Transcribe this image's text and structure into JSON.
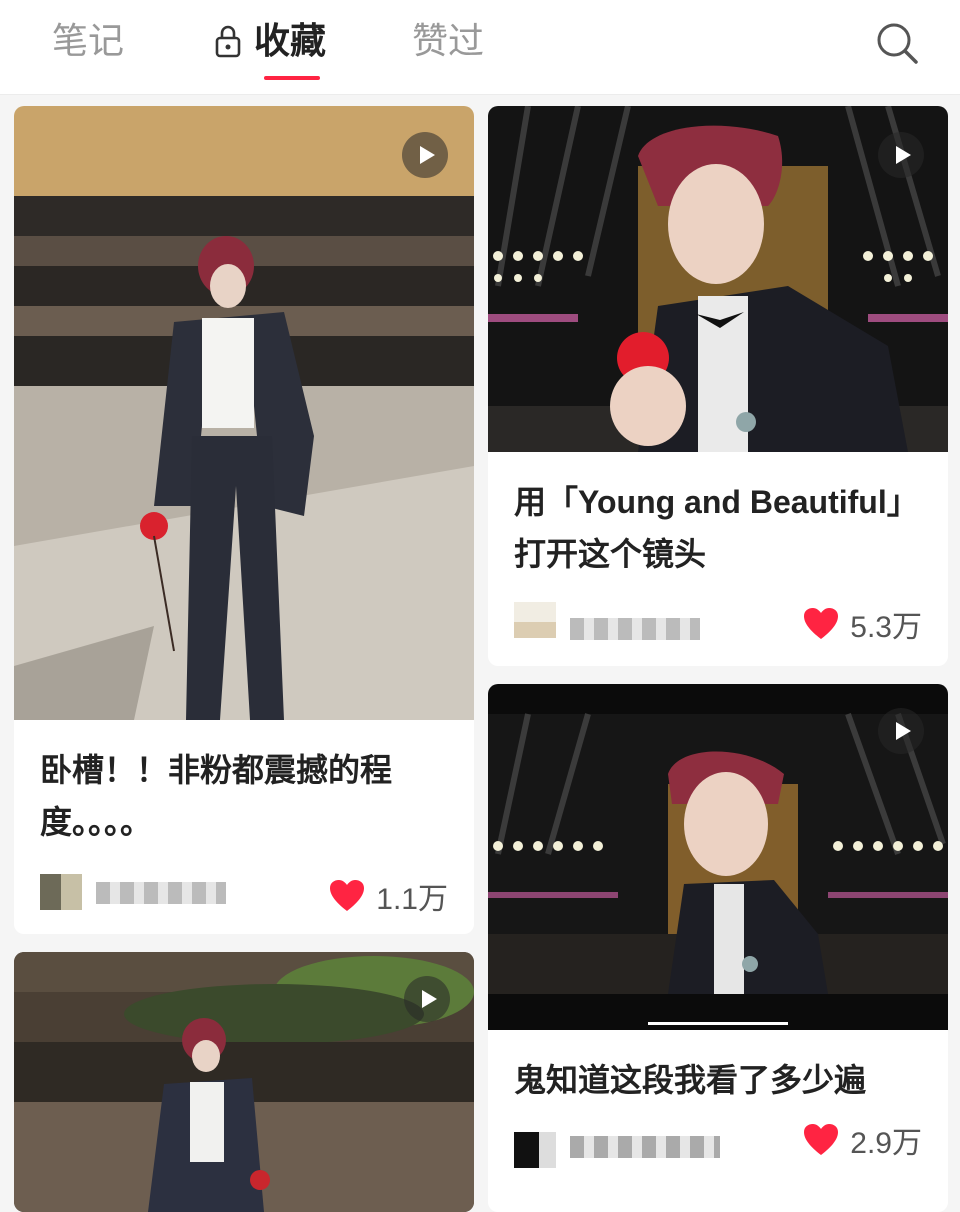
{
  "tabs": {
    "notes": "笔记",
    "favorites": "收藏",
    "liked": "赞过"
  },
  "colors": {
    "accent": "#ff2442",
    "heart": "#ff2442"
  },
  "feed": [
    {
      "title": "卧槽！！非粉都震撼的程度。。。。",
      "likes": "1.1万",
      "type": "video"
    },
    {
      "title": "用「Young and Beautiful」打开这个镜头",
      "likes": "5.3万",
      "type": "video"
    },
    {
      "title": "鬼知道这段我看了多少遍",
      "likes": "2.9万",
      "type": "video"
    },
    {
      "title": "",
      "likes": "",
      "type": "video"
    }
  ]
}
